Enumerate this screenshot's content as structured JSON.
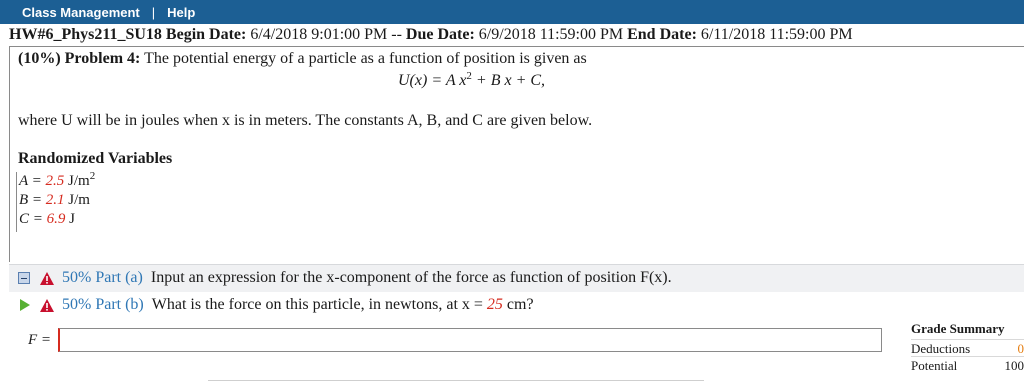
{
  "menu": {
    "class_management": "Class Management",
    "separator": "|",
    "help": "Help"
  },
  "assignment": {
    "name": "HW#6_Phys211_SU18",
    "begin_label": "Begin Date:",
    "begin_value": "6/4/2018 9:01:00 PM --",
    "due_label": "Due Date:",
    "due_value": "6/9/2018 11:59:00 PM",
    "end_label": "End Date:",
    "end_value": "6/11/2018 11:59:00 PM"
  },
  "problem": {
    "percent": "(10%)",
    "label": "Problem 4:",
    "statement": "The potential energy of a particle as a function of position is given as",
    "formula": {
      "lhs": "U(x) = A x",
      "exp": "2",
      "rhs": " + B x + C,"
    },
    "where": "where U will be in joules when x is in meters. The constants A, B, and C are given below."
  },
  "randomized": {
    "title": "Randomized Variables",
    "vars": [
      {
        "name": "A = ",
        "value": "2.5",
        "unit": " J/m",
        "exp": "2"
      },
      {
        "name": "B = ",
        "value": "2.1",
        "unit": " J/m"
      },
      {
        "name": "C = ",
        "value": "6.9",
        "unit": " J"
      }
    ]
  },
  "parts": [
    {
      "percent": "50% Part (a)",
      "text": "Input an expression for the x-component of the force as function of position F(x).",
      "icon": "minus-icon"
    },
    {
      "percent": "50% Part (b)",
      "text_before": "What is the force on this particle, in newtons, at x = ",
      "value": "25",
      "text_after": " cm?",
      "icon": "play-icon"
    }
  ],
  "answer": {
    "label": "F =",
    "value": ""
  },
  "grade_summary": {
    "title": "Grade Summary",
    "rows": [
      {
        "label": "Deductions",
        "value": "0"
      },
      {
        "label": "Potential",
        "value": "100"
      }
    ]
  },
  "colors": {
    "menubar": "#1c5f94",
    "accent_blue": "#2f77b5",
    "random_red": "#d62b1f",
    "warning_red": "#c8102e",
    "play_green": "#57b033",
    "deduction_orange": "#e57d10"
  }
}
